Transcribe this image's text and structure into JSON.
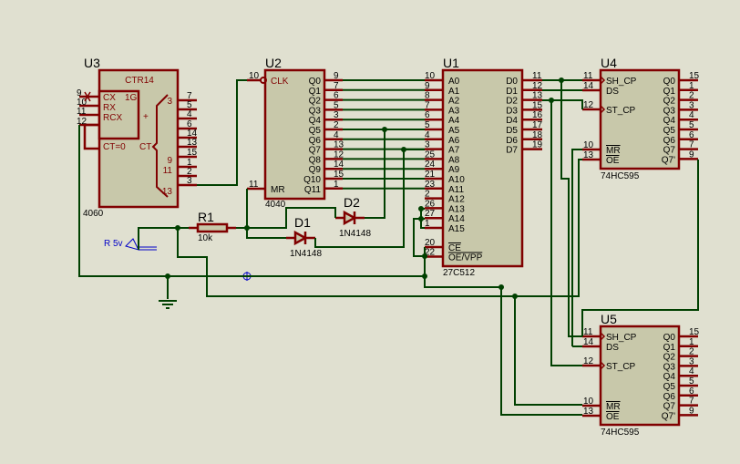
{
  "colors": {
    "background": "#e0e0d0",
    "component": "#800000",
    "body": "#c8c8aa",
    "wire": "#004000",
    "probe": "#0000c8"
  },
  "components": {
    "U3": {
      "ref": "U3",
      "part": "4060",
      "title": "CTR14",
      "inner": [
        "CX",
        "RX",
        "RCX",
        "1G",
        "+",
        "CT=0",
        "CT"
      ],
      "left_pins": [
        "9",
        "10",
        "11",
        "12"
      ],
      "right_pins": [
        "7",
        "5",
        "4",
        "6",
        "14",
        "13",
        "15",
        "1",
        "2",
        "3"
      ],
      "ct_labels": [
        "3",
        "9",
        "11",
        "13"
      ]
    },
    "U2": {
      "ref": "U2",
      "part": "4040",
      "clk": {
        "num": "10",
        "name": "CLK"
      },
      "mr": {
        "num": "11",
        "name": "MR"
      },
      "outputs": [
        [
          "9",
          "Q0"
        ],
        [
          "7",
          "Q1"
        ],
        [
          "6",
          "Q2"
        ],
        [
          "5",
          "Q3"
        ],
        [
          "3",
          "Q4"
        ],
        [
          "2",
          "Q5"
        ],
        [
          "4",
          "Q6"
        ],
        [
          "13",
          "Q7"
        ],
        [
          "12",
          "Q8"
        ],
        [
          "14",
          "Q9"
        ],
        [
          "15",
          "Q10"
        ],
        [
          "1",
          "Q11"
        ]
      ]
    },
    "U1": {
      "ref": "U1",
      "part": "27C512",
      "address": [
        [
          "10",
          "A0"
        ],
        [
          "9",
          "A1"
        ],
        [
          "8",
          "A2"
        ],
        [
          "7",
          "A3"
        ],
        [
          "6",
          "A4"
        ],
        [
          "5",
          "A5"
        ],
        [
          "4",
          "A6"
        ],
        [
          "3",
          "A7"
        ],
        [
          "25",
          "A8"
        ],
        [
          "24",
          "A9"
        ],
        [
          "21",
          "A10"
        ],
        [
          "23",
          "A11"
        ],
        [
          "2",
          "A12"
        ],
        [
          "26",
          "A13"
        ],
        [
          "27",
          "A14"
        ],
        [
          "1",
          "A15"
        ]
      ],
      "control": [
        [
          "20",
          "CE"
        ],
        [
          "22",
          "OE/VPP"
        ]
      ],
      "data": [
        [
          "11",
          "D0"
        ],
        [
          "12",
          "D1"
        ],
        [
          "13",
          "D2"
        ],
        [
          "15",
          "D3"
        ],
        [
          "16",
          "D4"
        ],
        [
          "17",
          "D5"
        ],
        [
          "18",
          "D6"
        ],
        [
          "19",
          "D7"
        ]
      ]
    },
    "U4": {
      "ref": "U4",
      "part": "74HC595"
    },
    "U5": {
      "ref": "U5",
      "part": "74HC595"
    },
    "R1": {
      "ref": "R1",
      "value": "10k"
    },
    "D1": {
      "ref": "D1",
      "value": "1N4148"
    },
    "D2": {
      "ref": "D2",
      "value": "1N4148"
    },
    "probe": {
      "label": "R 5v"
    }
  },
  "hc595": {
    "left": [
      [
        "11",
        "SH_CP"
      ],
      [
        "14",
        "DS"
      ],
      [
        "12",
        "ST_CP"
      ],
      [
        "10",
        "MR"
      ],
      [
        "13",
        "OE"
      ]
    ],
    "right": [
      [
        "15",
        "Q0"
      ],
      [
        "1",
        "Q1"
      ],
      [
        "2",
        "Q2"
      ],
      [
        "3",
        "Q3"
      ],
      [
        "4",
        "Q4"
      ],
      [
        "5",
        "Q5"
      ],
      [
        "6",
        "Q6"
      ],
      [
        "7",
        "Q7"
      ],
      [
        "9",
        "Q7'"
      ]
    ]
  }
}
